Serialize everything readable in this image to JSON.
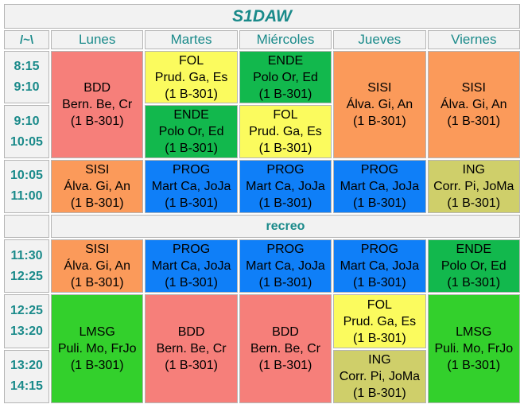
{
  "title": "S1DAW",
  "corner": "/~\\",
  "days": [
    "Lunes",
    "Martes",
    "Miércoles",
    "Jueves",
    "Viernes"
  ],
  "times": [
    {
      "start": "8:15",
      "end": "9:10"
    },
    {
      "start": "9:10",
      "end": "10:05"
    },
    {
      "start": "10:05",
      "end": "11:00"
    },
    {
      "start": "11:30",
      "end": "12:25"
    },
    {
      "start": "12:25",
      "end": "13:20"
    },
    {
      "start": "13:20",
      "end": "14:15"
    }
  ],
  "break_label": "recreo",
  "cells": {
    "mon_1": {
      "subject": "BDD",
      "teachers": "Bern. Be, Cr",
      "room": "(1 B-301)"
    },
    "tue_1": {
      "subject": "FOL",
      "teachers": "Prud. Ga, Es",
      "room": "(1 B-301)"
    },
    "wed_1": {
      "subject": "ENDE",
      "teachers": "Polo Or, Ed",
      "room": "(1 B-301)"
    },
    "thu_1": {
      "subject": "SISI",
      "teachers": "Álva. Gi, An",
      "room": "(1 B-301)"
    },
    "fri_1": {
      "subject": "SISI",
      "teachers": "Álva. Gi, An",
      "room": "(1 B-301)"
    },
    "tue_2": {
      "subject": "ENDE",
      "teachers": "Polo Or, Ed",
      "room": "(1 B-301)"
    },
    "wed_2": {
      "subject": "FOL",
      "teachers": "Prud. Ga, Es",
      "room": "(1 B-301)"
    },
    "mon_3": {
      "subject": "SISI",
      "teachers": "Álva. Gi, An",
      "room": "(1 B-301)"
    },
    "tue_3": {
      "subject": "PROG",
      "teachers": "Mart Ca, JoJa",
      "room": "(1 B-301)"
    },
    "wed_3": {
      "subject": "PROG",
      "teachers": "Mart Ca, JoJa",
      "room": "(1 B-301)"
    },
    "thu_3": {
      "subject": "PROG",
      "teachers": "Mart Ca, JoJa",
      "room": "(1 B-301)"
    },
    "fri_3": {
      "subject": "ING",
      "teachers": "Corr. Pi, JoMa",
      "room": "(1 B-301)"
    },
    "mon_4": {
      "subject": "SISI",
      "teachers": "Álva. Gi, An",
      "room": "(1 B-301)"
    },
    "tue_4": {
      "subject": "PROG",
      "teachers": "Mart Ca, JoJa",
      "room": "(1 B-301)"
    },
    "wed_4": {
      "subject": "PROG",
      "teachers": "Mart Ca, JoJa",
      "room": "(1 B-301)"
    },
    "thu_4": {
      "subject": "PROG",
      "teachers": "Mart Ca, JoJa",
      "room": "(1 B-301)"
    },
    "fri_4": {
      "subject": "ENDE",
      "teachers": "Polo Or, Ed",
      "room": "(1 B-301)"
    },
    "mon_5": {
      "subject": "LMSG",
      "teachers": "Puli. Mo, FrJo",
      "room": "(1 B-301)"
    },
    "tue_5": {
      "subject": "BDD",
      "teachers": "Bern. Be, Cr",
      "room": "(1 B-301)"
    },
    "wed_5": {
      "subject": "BDD",
      "teachers": "Bern. Be, Cr",
      "room": "(1 B-301)"
    },
    "thu_5": {
      "subject": "FOL",
      "teachers": "Prud. Ga, Es",
      "room": "(1 B-301)"
    },
    "fri_5": {
      "subject": "LMSG",
      "teachers": "Puli. Mo, FrJo",
      "room": "(1 B-301)"
    },
    "thu_6": {
      "subject": "ING",
      "teachers": "Corr. Pi, JoMa",
      "room": "(1 B-301)"
    }
  },
  "colors": {
    "BDD": "#f67f7a",
    "FOL": "#fbfb5e",
    "ENDE": "#12b84d",
    "SISI": "#fb9a5a",
    "PROG": "#0f7ff8",
    "ING": "#cfcf6a",
    "LMSG": "#33d02c",
    "header_text": "#1a8a8a",
    "header_bg": "#f2f2f2"
  }
}
